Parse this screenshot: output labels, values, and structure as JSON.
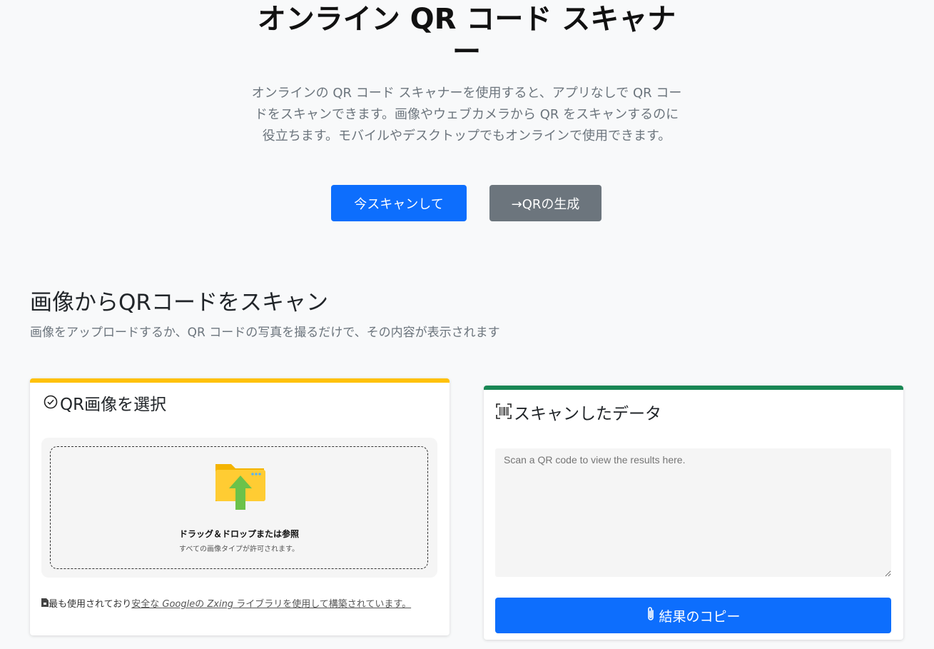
{
  "hero": {
    "title": "オンライン QR コード スキャナー",
    "description": "オンラインの QR コード スキャナーを使用すると、アプリなしで QR コードをスキャンできます。画像やウェブカメラから QR をスキャンするのに役立ちます。モバイルやデスクトップでもオンラインで使用できます。",
    "scan_button": "今スキャンして",
    "generate_button": "→QRの生成"
  },
  "section": {
    "title": "画像からQRコードをスキャン",
    "subtitle": "画像をアップロードするか、QR コードの写真を撮るだけで、その内容が表示されます"
  },
  "upload_card": {
    "title": "QR画像を選択",
    "drop_main": "ドラッグ＆ドロップまたは参照",
    "drop_sub": "すべての画像タイプが許可されます。",
    "note_prefix": "最も使用されており",
    "note_link_1": "安全な ",
    "note_link_google": "Google",
    "note_link_2": "の ",
    "note_link_zxing": "Zxing",
    "note_link_3": " ライブラリを使用して構築されています。"
  },
  "result_card": {
    "title": "スキャンしたデータ",
    "placeholder": "Scan a QR code to view the results here.",
    "copy_button": "結果のコピー"
  },
  "colors": {
    "primary": "#0d6efd",
    "secondary": "#6c757d",
    "warning_border": "#ffc107",
    "success_border": "#198754"
  },
  "icons": {
    "upload": "folder-upload-icon",
    "check": "check-circle-icon",
    "scan": "barcode-scan-icon",
    "copy": "paperclip-icon",
    "file": "file-lock-icon"
  }
}
